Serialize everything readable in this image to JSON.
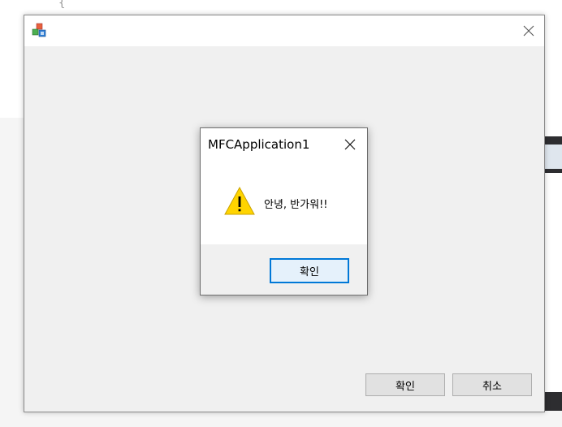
{
  "background": {
    "code_brace": "{"
  },
  "main_window": {
    "ok_label": "확인",
    "cancel_label": "취소"
  },
  "message_box": {
    "title": "MFCApplication1",
    "message": "안녕, 반가워!!",
    "ok_label": "확인",
    "icon": "warning-icon"
  },
  "colors": {
    "accent": "#0078d7",
    "dialog_bg": "#f0f0f0",
    "warning_fill": "#ffd400"
  }
}
